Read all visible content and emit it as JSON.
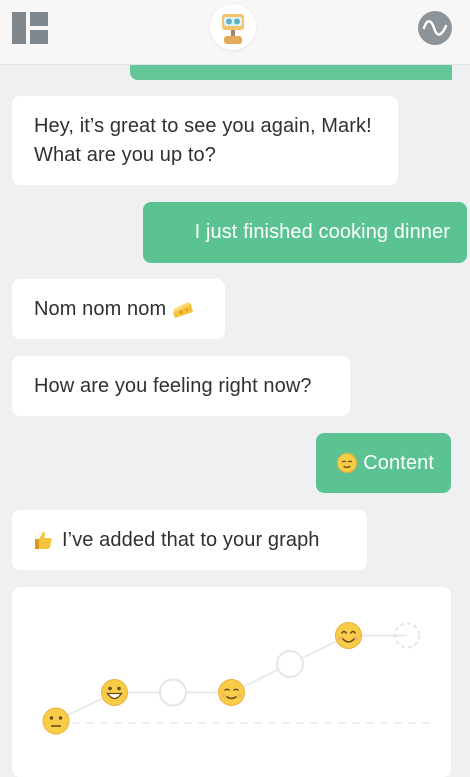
{
  "header": {
    "menu_icon": "layout-grid-icon",
    "avatar_icon": "robot-avatar-icon",
    "activity_icon": "pulse-wave-icon"
  },
  "messages": [
    {
      "sender": "bot",
      "text": "Hey, it’s great to see you again, Mark! What are you up to?"
    },
    {
      "sender": "user",
      "text": "I just finished cooking dinner"
    },
    {
      "sender": "bot",
      "text": "Nom nom nom",
      "icon": "cheese-icon"
    },
    {
      "sender": "bot",
      "text": "How are you feeling right now?"
    },
    {
      "sender": "user",
      "text": "Content",
      "icon": "relieved-face-icon"
    },
    {
      "sender": "bot",
      "text": "I’ve added that to your graph",
      "icon": "thumbs-up-icon"
    }
  ],
  "mood_graph": {
    "points": [
      {
        "mood": "neutral",
        "level": 0
      },
      {
        "mood": "grinning",
        "level": 1
      },
      {
        "mood": "empty",
        "level": 1
      },
      {
        "mood": "relieved",
        "level": 1
      },
      {
        "mood": "empty",
        "level": 2
      },
      {
        "mood": "smiling",
        "level": 3
      },
      {
        "mood": "placeholder",
        "level": 3
      }
    ]
  },
  "colors": {
    "user_bubble": "#5ac391",
    "bot_bubble": "#ffffff",
    "background": "#eef0f1",
    "icon_gray": "#8c9499"
  }
}
